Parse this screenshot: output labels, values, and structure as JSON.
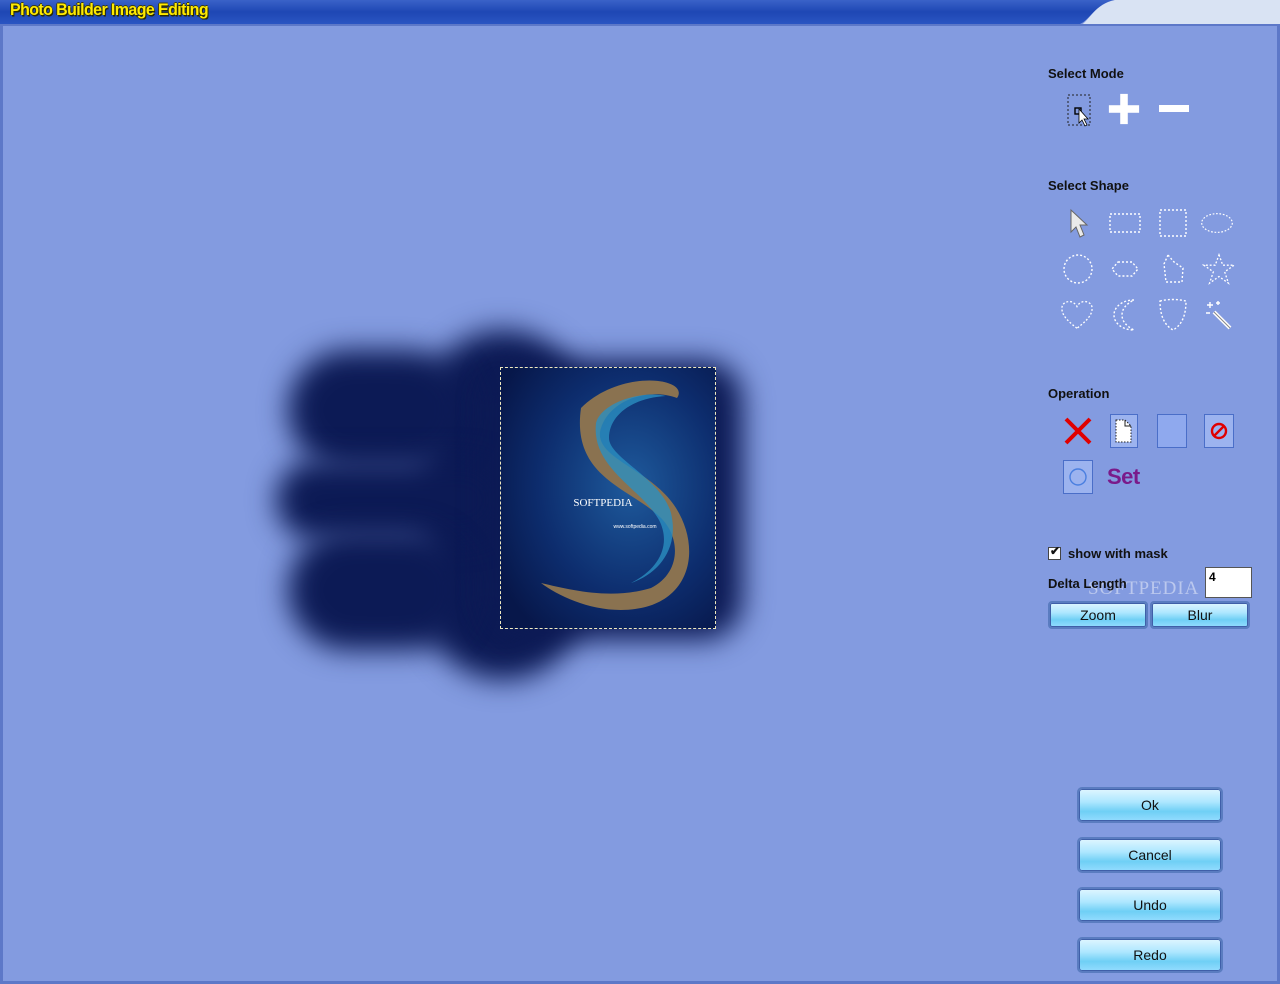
{
  "window": {
    "title": "Photo Builder Image Editing"
  },
  "panel": {
    "select_mode_label": "Select Mode",
    "select_shape_label": "Select Shape",
    "operation_label": "Operation",
    "set_label": "Set",
    "show_with_mask_label": "show with mask",
    "show_with_mask_checked": true,
    "delta_length_label": "Delta Length",
    "delta_length_value": "4",
    "zoom_label": "Zoom",
    "blur_label": "Blur",
    "watermark": "SOFTPEDIA"
  },
  "photo": {
    "brand": "SOFTPEDIA",
    "url": "www.softpedia.com"
  },
  "actions": {
    "ok": "Ok",
    "cancel": "Cancel",
    "undo": "Undo",
    "redo": "Redo"
  },
  "colors": {
    "background": "#839be0",
    "title_text": "#ffea00",
    "set_text": "#7a1a8a",
    "delete_x": "#e00000"
  }
}
